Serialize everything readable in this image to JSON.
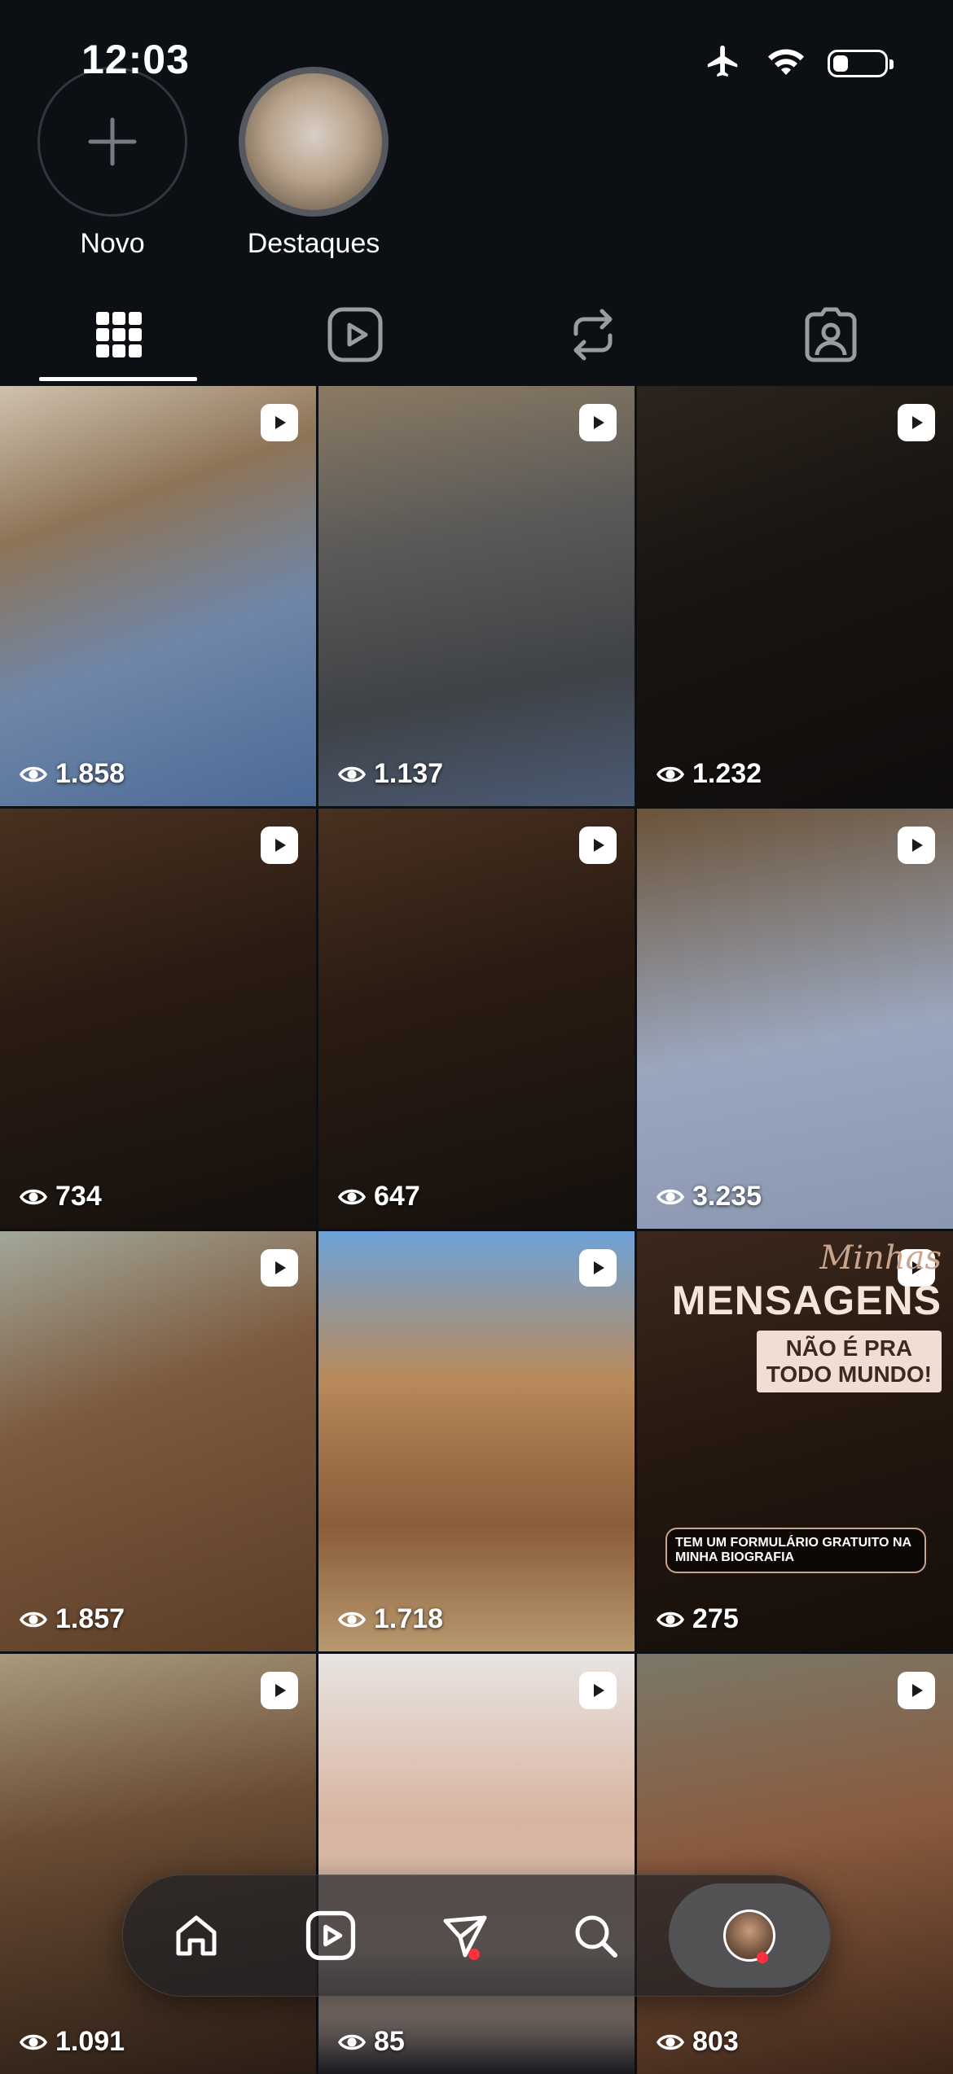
{
  "status_bar": {
    "time": "12:03",
    "battery_level": 0.3
  },
  "highlights": [
    {
      "label": "Novo"
    },
    {
      "label": "Destaques"
    }
  ],
  "tabs": [
    {
      "name": "grid-icon",
      "active": true
    },
    {
      "name": "reels-icon",
      "active": false
    },
    {
      "name": "reposts-icon",
      "active": false
    },
    {
      "name": "tagged-icon",
      "active": false
    }
  ],
  "posts": [
    {
      "views": "1.858",
      "bg": "linear-gradient(160deg,#cfc1ae 0%,#8d7457 30%,#6f86a8 60%,#4b6a96 100%)"
    },
    {
      "views": "1.137",
      "bg": "linear-gradient(170deg,#8b7a63 0%,#5b5a58 35%,#3f4246 70%,#4a5a74 100%)"
    },
    {
      "views": "1.232",
      "bg": "linear-gradient(160deg,#2c241d 0%,#1a1512 40%,#0f0d0c 100%)"
    },
    {
      "views": "734",
      "bg": "linear-gradient(165deg,#4a3120 0%,#2b1c13 40%,#14100d 100%)"
    },
    {
      "views": "647",
      "bg": "linear-gradient(165deg,#4a3120 0%,#2b1c13 40%,#14100d 100%)"
    },
    {
      "views": "3.235",
      "bg": "linear-gradient(170deg,#6b5338 0%,#9aa6bd 55%,#8a97b0 100%)"
    },
    {
      "views": "1.857",
      "bg": "linear-gradient(160deg,#a3a79a 0%,#7c5a3e 40%,#5b3c26 100%)"
    },
    {
      "views": "1.718",
      "bg": "linear-gradient(180deg,#6ea2d8 0%,#b88a5c 35%,#8a5c3a 70%,#b8996e 100%)"
    },
    {
      "views": "275",
      "bg": "linear-gradient(165deg,#3b281c 0%,#24170f 50%,#140e0a 100%)",
      "overlay": {
        "line1": "Minhas",
        "line2": "MENSAGENS",
        "line3a": "NÃO É PRA",
        "line3b": "TODO MUNDO!",
        "box": "TEM UM FORMULÁRIO GRATUITO NA MINHA BIOGRAFIA"
      }
    },
    {
      "views": "1.091",
      "bg": "linear-gradient(170deg,#a89a7c 0%,#6a4c34 40%,#2a1d15 100%)"
    },
    {
      "views": "85",
      "bg": "linear-gradient(180deg,#e8e4e2 0%,#d8b4a0 40%,#e2c8b8 70%,#1a1a1f 100%)"
    },
    {
      "views": "803",
      "bg": "linear-gradient(170deg,#7a7868 0%,#8a5a3e 45%,#3a2418 100%)"
    }
  ],
  "nav": [
    {
      "name": "home-icon"
    },
    {
      "name": "reels-icon"
    },
    {
      "name": "messages-icon",
      "dot": true
    },
    {
      "name": "search-icon"
    },
    {
      "name": "profile-avatar",
      "dot": true,
      "active": true
    }
  ]
}
